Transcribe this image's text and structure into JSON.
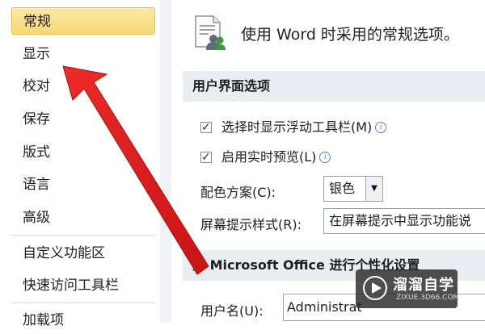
{
  "sidebar": {
    "items": [
      {
        "label": "常规"
      },
      {
        "label": "显示"
      },
      {
        "label": "校对"
      },
      {
        "label": "保存"
      },
      {
        "label": "版式"
      },
      {
        "label": "语言"
      },
      {
        "label": "高级"
      },
      {
        "label": "自定义功能区"
      },
      {
        "label": "快速访问工具栏"
      },
      {
        "label": "加载项"
      }
    ],
    "selected_index": 0
  },
  "main": {
    "header_text": "使用 Word 时采用的常规选项。",
    "ui_options": {
      "title": "用户界面选项",
      "show_mini_toolbar": {
        "label": "选择时显示浮动工具栏(M)",
        "checked": true
      },
      "live_preview": {
        "label": "启用实时预览(L)",
        "checked": true
      },
      "color_scheme": {
        "label": "配色方案(C):",
        "value": "银色"
      },
      "screentip_style": {
        "label": "屏幕提示样式(R):",
        "value": "在屏幕提示中显示功能说"
      }
    },
    "personalize": {
      "title": "对 Microsoft Office 进行个性化设置",
      "username": {
        "label": "用户名(U):",
        "value": "Administrat"
      }
    }
  },
  "watermark": {
    "main": "溜溜自学",
    "sub": "ZIXUE.3D66.COM"
  },
  "colors": {
    "selected_bg": "#f8d774",
    "arrow": "#e21b1b",
    "group_bar": "#e9ecf0"
  }
}
